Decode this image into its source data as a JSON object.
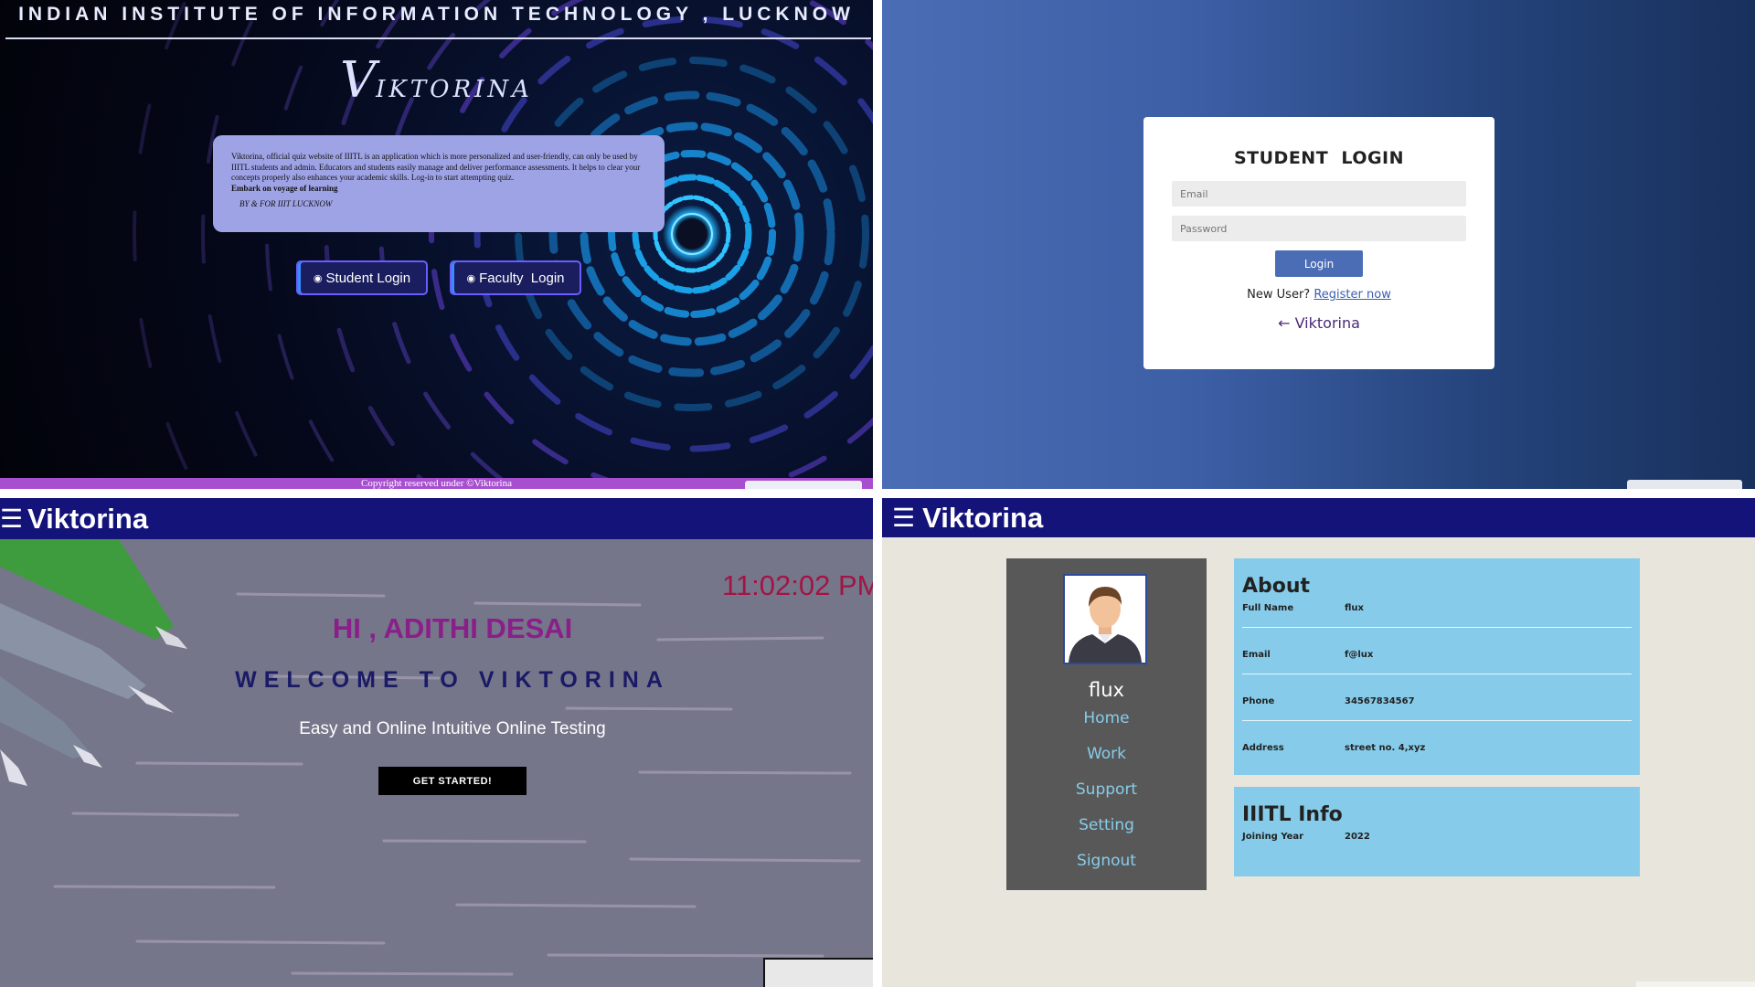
{
  "landing": {
    "institute": "INDIAN INSTITUTE OF INFORMATION TECHNOLOGY , LUCKNOW",
    "brand_initial": "V",
    "brand_rest": "IKTORINA",
    "description": "Viktorina, official quiz website of IIITL is an application which is more personalized and user-friendly, can only be used by IIITL students and admin. Educators and students easily manage and deliver performance assessments. It helps to clear your concepts properly also enhances your academic skills. Log-in to start attempting quiz.",
    "tagline": "Embark on voyage of learning",
    "byline": "BY & FOR IIIT LUCKNOW",
    "student_login": "Student Login",
    "faculty_login": "Faculty  Login",
    "login_icon": "user-circle-icon",
    "copyright": "Copyright reserved under ©Viktorina"
  },
  "login": {
    "heading": "STUDENT  LOGIN",
    "email_placeholder": "Email",
    "password_placeholder": "Password",
    "login_button": "Login",
    "new_user": "New User?",
    "register_link": "Register now",
    "back_link": "← Viktorina"
  },
  "welcome": {
    "nav_title": "Viktorina",
    "menu_icon": "☰",
    "clock": "11:02:02 PM",
    "greeting": "HI , ADITHI DESAI",
    "welcome": "WELCOME TO VIKTORINA",
    "tagline": "Easy and Online Intuitive Online Testing",
    "cta": "GET STARTED!"
  },
  "profile": {
    "nav_title": "Viktorina",
    "menu_icon": "☰",
    "name": "flux",
    "menu": [
      "Home",
      "Work",
      "Support",
      "Setting",
      "Signout"
    ],
    "about": {
      "heading": "About",
      "rows": [
        {
          "label": "Full Name",
          "value": "flux"
        },
        {
          "label": "Email",
          "value": "f@lux"
        },
        {
          "label": "Phone",
          "value": "34567834567"
        },
        {
          "label": "Address",
          "value": "street no. 4,xyz"
        }
      ]
    },
    "info": {
      "heading": "IIITL Info",
      "rows": [
        {
          "label": "Joining Year",
          "value": "2022"
        }
      ]
    }
  },
  "colors": {
    "navy_nav": "#13137a",
    "login_blue": "#4a6db5",
    "card_blue": "#86ccea",
    "sidebar_gray": "#595858",
    "greeting_purple": "#8a1f8a",
    "clock_red": "#a31445"
  }
}
